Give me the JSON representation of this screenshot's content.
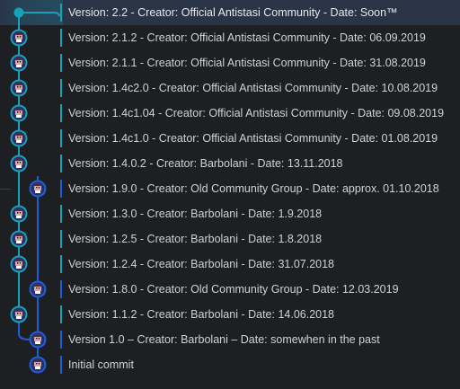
{
  "colors": {
    "teal": "#17a2b8",
    "blue": "#1f5fd6",
    "selected_bg": "#2a3447",
    "text": "#cfd2d6"
  },
  "icons": {
    "avatar": "antistasi-guerrilla-avatar-icon"
  },
  "commits": [
    {
      "message": "Version: 2.2 - Creator: Official Antistasi Community - Date: Soon™",
      "lane": "teal",
      "selected": true
    },
    {
      "message": "Version: 2.1.2 - Creator: Official Antistasi Community - Date: 06.09.2019",
      "lane": "teal"
    },
    {
      "message": "Version: 2.1.1 - Creator: Official Antistasi Community - Date: 31.08.2019",
      "lane": "teal"
    },
    {
      "message": "Version: 1.4c2.0 - Creator: Official Antistasi Community - Date: 10.08.2019",
      "lane": "teal"
    },
    {
      "message": "Version: 1.4c1.04 - Creator: Official Antistasi Community - Date: 09.08.2019",
      "lane": "teal"
    },
    {
      "message": "Version: 1.4c1.0 - Creator: Official Antistasi Community - Date: 01.08.2019",
      "lane": "teal"
    },
    {
      "message": "Version: 1.4.0.2 - Creator: Barbolani - Date: 13.11.2018",
      "lane": "teal"
    },
    {
      "message": "Version: 1.9.0 - Creator: Old Community Group - Date: approx. 01.10.2018",
      "lane": "blue"
    },
    {
      "message": "Version: 1.3.0 - Creator: Barbolani - Date: 1.9.2018",
      "lane": "teal"
    },
    {
      "message": "Version: 1.2.5 - Creator: Barbolani - Date: 1.8.2018",
      "lane": "teal"
    },
    {
      "message": "Version: 1.2.4 - Creator: Barbolani - Date: 31.07.2018",
      "lane": "teal"
    },
    {
      "message": "Version: 1.8.0 - Creator: Old Community Group - Date: 12.03.2019",
      "lane": "blue"
    },
    {
      "message": "Version: 1.1.2 - Creator: Barbolani - Date: 14.06.2018",
      "lane": "teal"
    },
    {
      "message": "Version 1.0 – Creator: Barbolani – Date: somewhen in the past",
      "lane": "blue"
    },
    {
      "message": "Initial commit",
      "lane": "blue"
    }
  ]
}
